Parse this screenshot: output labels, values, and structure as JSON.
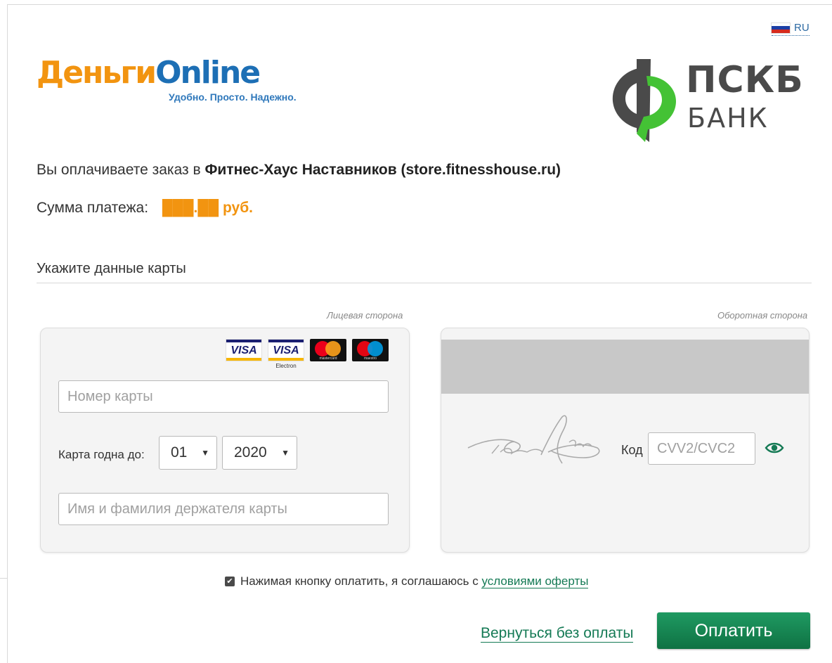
{
  "language": {
    "code": "RU",
    "flag_icon": "russia-flag-icon"
  },
  "brand": {
    "dengi_part1": "Деньги",
    "dengi_part2": "Online",
    "dengi_tagline": "Удобно. Просто. Надежно.",
    "bank_name_line1": "ПСКБ",
    "bank_name_line2": "БАНК",
    "colors": {
      "orange": "#f29410",
      "blue": "#1d6fb5",
      "green": "#157a55",
      "bank_green": "#44c235",
      "bank_gray": "#4a4a4a"
    }
  },
  "order": {
    "prefix": "Вы оплачиваете заказ в ",
    "merchant": "Фитнес-Хаус Наставников (store.fitnesshouse.ru)"
  },
  "payment": {
    "label": "Сумма платежа:",
    "amount": "███.██ руб."
  },
  "card_section": {
    "title": "Укажите данные карты",
    "front_label": "Лицевая сторона",
    "back_label": "Оборотная сторона"
  },
  "card_front": {
    "payment_logos": [
      {
        "icon": "visa-icon",
        "text": "VISA"
      },
      {
        "icon": "visa-electron-icon",
        "text": "VISA",
        "caption": "Electron"
      },
      {
        "icon": "mastercard-icon",
        "caption": "mastercard"
      },
      {
        "icon": "maestro-icon",
        "caption": "maestro"
      }
    ],
    "card_number_placeholder": "Номер карты",
    "expiry_label": "Карта годна до:",
    "expiry_month": "01",
    "expiry_year": "2020",
    "holder_placeholder": "Имя и фамилия держателя карты"
  },
  "card_back": {
    "code_label": "Код",
    "cvv_placeholder": "CVV2/CVC2",
    "eye_icon": "eye-icon"
  },
  "agreement": {
    "checked": true,
    "text": "Нажимая кнопку оплатить, я соглашаюсь с ",
    "link": "условиями оферты"
  },
  "actions": {
    "back_link": "Вернуться без оплаты",
    "pay_button": "Оплатить"
  }
}
